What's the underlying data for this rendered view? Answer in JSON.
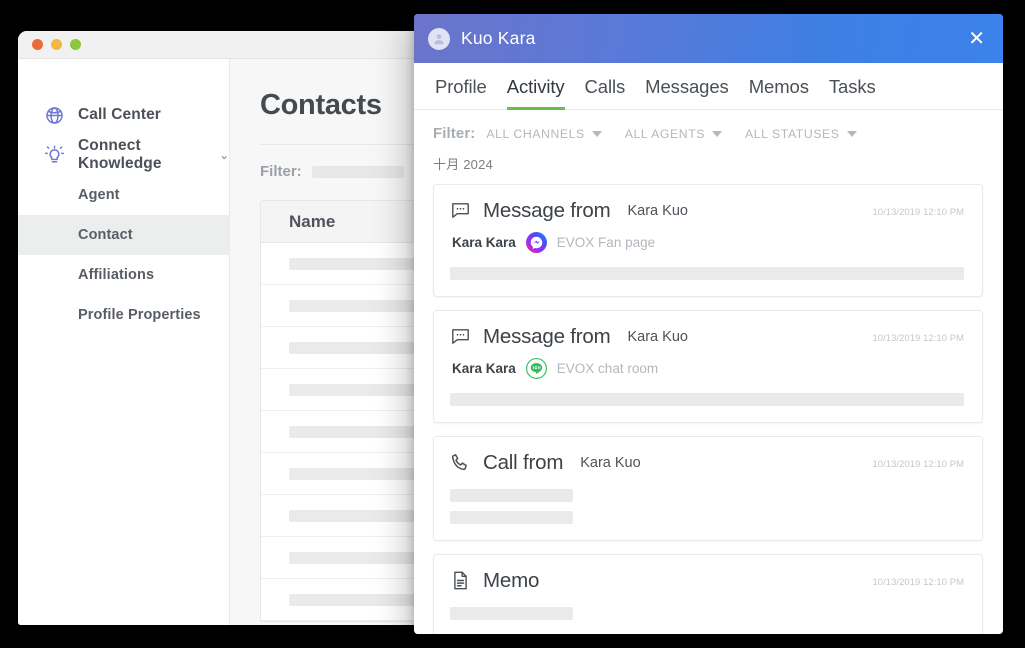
{
  "background_window": {
    "traffic_lights": [
      "close",
      "minimize",
      "maximize"
    ],
    "sidebar": {
      "items": [
        {
          "label": "Call Center",
          "icon": "globe-icon",
          "type": "top",
          "active": false
        },
        {
          "label": "Connect Knowledge",
          "icon": "lightbulb-icon",
          "type": "top",
          "active": false,
          "expandable": true
        },
        {
          "label": "Agent",
          "type": "sub",
          "active": false
        },
        {
          "label": "Contact",
          "type": "sub",
          "active": true
        },
        {
          "label": "Affiliations",
          "type": "sub",
          "active": false
        },
        {
          "label": "Profile Properties",
          "type": "sub",
          "active": false
        }
      ]
    },
    "content": {
      "page_title": "Contacts",
      "filter_label": "Filter:",
      "filter_value": "",
      "table": {
        "columns": [
          "Name"
        ],
        "skeleton_row_count": 9
      }
    }
  },
  "modal": {
    "header": {
      "title": "Kuo Kara",
      "avatar_icon": "user-avatar-icon",
      "close_icon": "close-icon",
      "gradient_from": "#6b74c9",
      "gradient_to": "#3b82ec"
    },
    "tabs": [
      {
        "label": "Profile",
        "active": false
      },
      {
        "label": "Activity",
        "active": true
      },
      {
        "label": "Calls",
        "active": false
      },
      {
        "label": "Messages",
        "active": false
      },
      {
        "label": "Memos",
        "active": false
      },
      {
        "label": "Tasks",
        "active": false
      }
    ],
    "active_tab_accent": "#69bd45",
    "filter": {
      "label": "Filter:",
      "dropdowns": [
        {
          "label": "ALL CHANNELS"
        },
        {
          "label": "ALL AGENTS"
        },
        {
          "label": "ALL STATUSES"
        }
      ]
    },
    "month_label": "十月 2024",
    "cards": [
      {
        "icon": "message-bubble-icon",
        "title": "Message from",
        "person": "Kara Kuo",
        "timestamp": "10/13/2019 12:10 PM",
        "sub_name": "Kara Kara",
        "channel_icon": "facebook-messenger-icon",
        "channel": "EVOX Fan page",
        "skeleton": "full"
      },
      {
        "icon": "message-bubble-icon",
        "title": "Message from",
        "person": "Kara Kuo",
        "timestamp": "10/13/2019 12:10 PM",
        "sub_name": "Kara Kara",
        "channel_icon": "line-chat-icon",
        "channel": "EVOX chat room",
        "skeleton": "full"
      },
      {
        "icon": "phone-icon",
        "title": "Call from",
        "person": "Kara Kuo",
        "timestamp": "10/13/2019 12:10 PM",
        "sub_name": "",
        "channel_icon": "",
        "channel": "",
        "skeleton": "double-short"
      },
      {
        "icon": "document-icon",
        "title": "Memo",
        "person": "",
        "timestamp": "10/13/2019 12:10 PM",
        "sub_name": "",
        "channel_icon": "",
        "channel": "",
        "skeleton": "short"
      }
    ]
  }
}
